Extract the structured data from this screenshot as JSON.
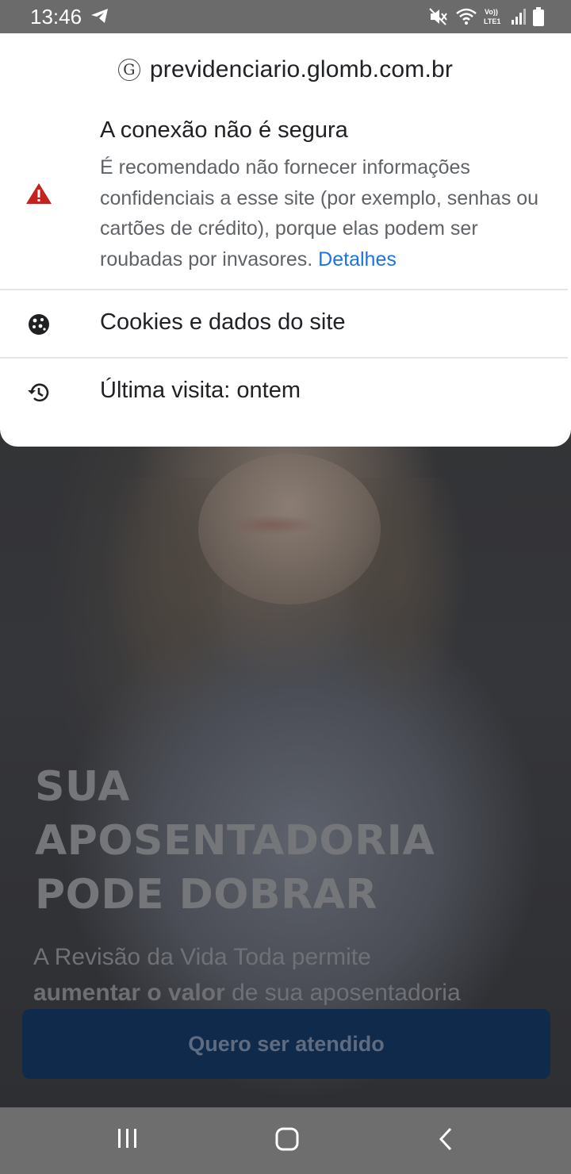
{
  "status_bar": {
    "time": "13:46",
    "icons": [
      "telegram-icon",
      "mute-icon",
      "wifi-icon",
      "volte-lte-icon",
      "signal-icon",
      "battery-icon"
    ]
  },
  "popup": {
    "url": "previdenciario.glomb.com.br",
    "site_icon": "G",
    "security_title": "A conexão não é segura",
    "security_description": "É recomendado não fornecer informações confidenciais a esse site (por exemplo, senhas ou cartões de crédito), porque elas podem ser roubadas por invasores.",
    "details_link": "Detalhes",
    "cookies_label": "Cookies e dados do site",
    "last_visit_label": "Última visita: ontem"
  },
  "page": {
    "hero_title_lines": [
      "SUA",
      "APOSENTADORIA",
      "PODE DOBRAR"
    ],
    "hero_text_start": "A Revisão da Vida Toda permite",
    "hero_text_bold": "aumentar o valor",
    "hero_text_end": "de sua aposentadoria",
    "cta_label": "Quero ser atendido"
  },
  "colors": {
    "warning": "#c5221f",
    "link": "#1a73e8",
    "cta_background": "#102a4c"
  }
}
